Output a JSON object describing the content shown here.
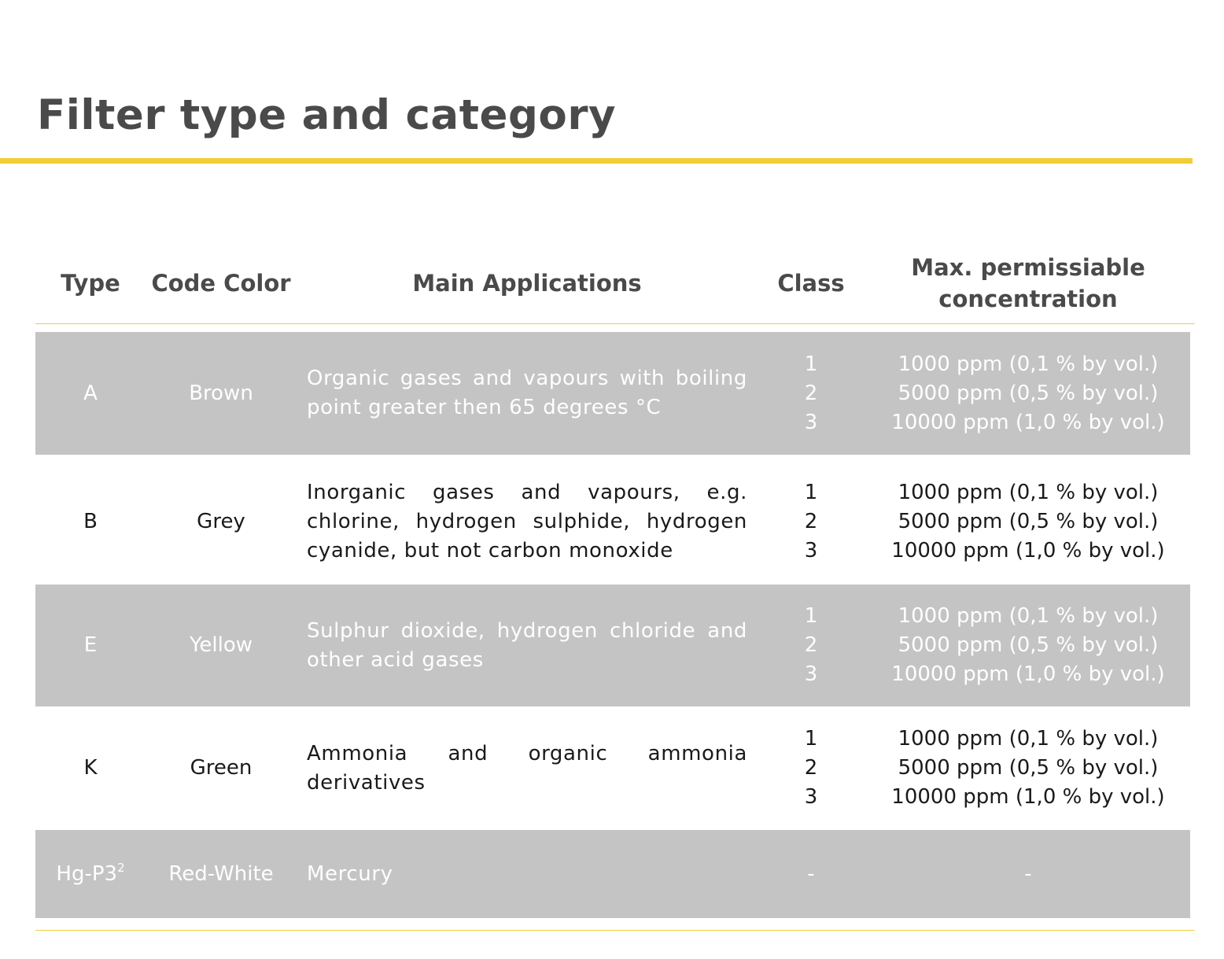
{
  "title": "Filter type and category",
  "columns": {
    "type": "Type",
    "code_color": "Code Color",
    "main_applications": "Main Applications",
    "class": "Class",
    "max_concentration_line1": "Max. permissiable",
    "max_concentration_line2": "concentration"
  },
  "rows": [
    {
      "type": "A",
      "type_note": "",
      "code_color": "Brown",
      "application": "Organic gases and vapours with boiling point greater then 65 degrees °C",
      "classes": [
        "1",
        "2",
        "3"
      ],
      "concentrations": [
        "1000 ppm (0,1 % by vol.)",
        "5000 ppm (0,5 % by vol.)",
        "10000 ppm (1,0 % by vol.)"
      ]
    },
    {
      "type": "B",
      "type_note": "",
      "code_color": "Grey",
      "application": "Inorganic gases and vapours, e.g. chlorine, hydrogen sulphide, hydrogen cyanide, but not carbon monoxide",
      "classes": [
        "1",
        "2",
        "3"
      ],
      "concentrations": [
        "1000 ppm (0,1 % by vol.)",
        "5000 ppm (0,5 % by vol.)",
        "10000 ppm (1,0 % by vol.)"
      ]
    },
    {
      "type": "E",
      "type_note": "",
      "code_color": "Yellow",
      "application": "Sulphur dioxide, hydrogen chloride and other acid gases",
      "classes": [
        "1",
        "2",
        "3"
      ],
      "concentrations": [
        "1000 ppm (0,1 % by vol.)",
        "5000 ppm (0,5 % by vol.)",
        "10000 ppm (1,0 % by vol.)"
      ]
    },
    {
      "type": "K",
      "type_note": "",
      "code_color": "Green",
      "application": "Ammonia and organic ammonia derivatives",
      "classes": [
        "1",
        "2",
        "3"
      ],
      "concentrations": [
        "1000 ppm (0,1 % by vol.)",
        "5000 ppm (0,5 % by vol.)",
        "10000 ppm (1,0 % by vol.)"
      ]
    },
    {
      "type": "Hg-P3",
      "type_note": "2",
      "code_color": "Red-White",
      "application": "Mercury",
      "classes": [
        "-"
      ],
      "concentrations": [
        "-"
      ]
    }
  ],
  "colors": {
    "accent_rule": "#f2cd37",
    "shaded_row": "#c4c4c4",
    "heading_text": "#4a4a4a"
  }
}
